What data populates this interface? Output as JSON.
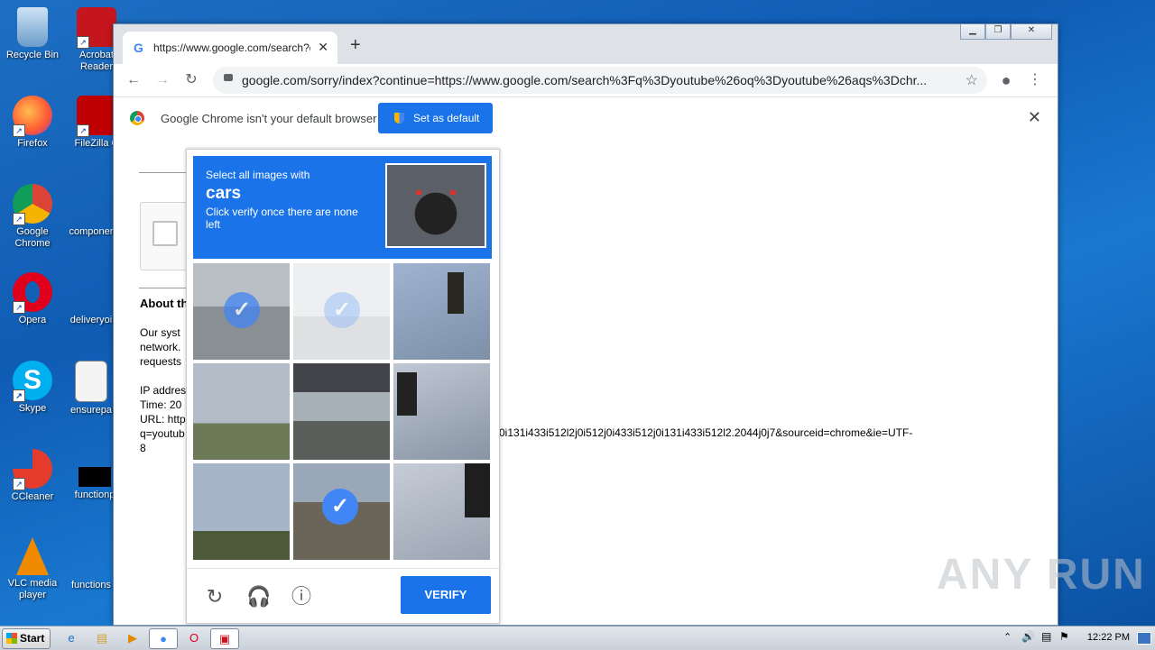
{
  "desktop": {
    "icons": [
      {
        "label": "Recycle Bin"
      },
      {
        "label": "Acrobat Reader"
      },
      {
        "label": "Firefox"
      },
      {
        "label": "FileZilla C"
      },
      {
        "label": "Google Chrome"
      },
      {
        "label": "componer"
      },
      {
        "label": "Opera"
      },
      {
        "label": "deliveryoi"
      },
      {
        "label": "Skype"
      },
      {
        "label": "ensurepa"
      },
      {
        "label": "CCleaner"
      },
      {
        "label": "functionp"
      },
      {
        "label": "VLC media player"
      },
      {
        "label": "functions"
      }
    ]
  },
  "browser": {
    "tab_title": "https://www.google.com/search?q=",
    "tab_favicon": "G",
    "new_tab": "+",
    "url_display": "google.com/sorry/index?continue=https://www.google.com/search%3Fq%3Dyoutube%26oq%3Dyoutube%26aqs%3Dchr...",
    "infobar": {
      "message": "Google Chrome isn't your default browser",
      "button": "Set as default"
    }
  },
  "page": {
    "about_heading": "About th",
    "para_lines": [
      "Our syst",
      "network.",
      "requests"
    ],
    "ip_lines": [
      "IP addres",
      "Time: 20",
      "URL: http",
      "q=youtub",
      "8"
    ],
    "url_tail": "0i131i433i512l2j0i512j0i433i512j0i131i433i512l2.2044j0j7&sourceid=chrome&ie=UTF-"
  },
  "captcha": {
    "line1": "Select all images with",
    "target": "cars",
    "line3": "Click verify once there are none left",
    "verify": "VERIFY",
    "tiles": [
      {
        "scene": "road",
        "selected": true,
        "faded": false
      },
      {
        "scene": "sky-road",
        "selected": true,
        "faded": true
      },
      {
        "scene": "traffic-light",
        "selected": false,
        "faded": false
      },
      {
        "scene": "field",
        "selected": false,
        "faded": false
      },
      {
        "scene": "bridge",
        "selected": false,
        "faded": false
      },
      {
        "scene": "traffic-light-palm",
        "selected": false,
        "faded": false
      },
      {
        "scene": "trees",
        "selected": false,
        "faded": false
      },
      {
        "scene": "street-cars",
        "selected": true,
        "faded": false
      },
      {
        "scene": "traffic-light-2",
        "selected": false,
        "faded": false
      }
    ]
  },
  "taskbar": {
    "start": "Start",
    "clock": "12:22 PM"
  },
  "watermark": "ANY RUN"
}
